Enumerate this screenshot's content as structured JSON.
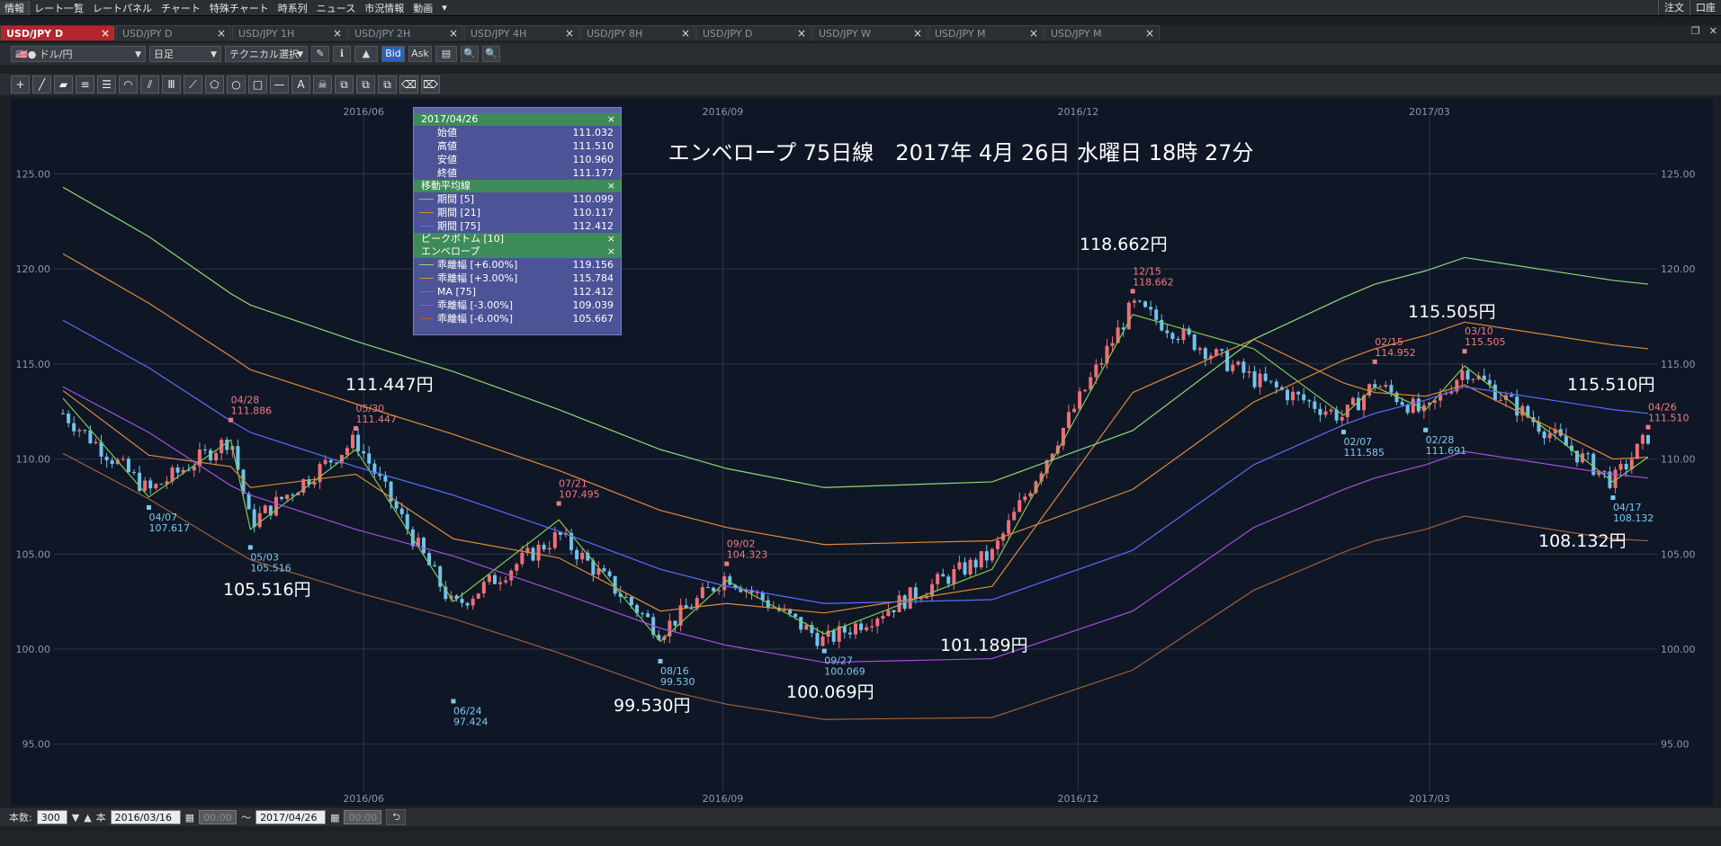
{
  "menu": {
    "items": [
      "情報",
      "レート一覧",
      "レートパネル",
      "チャート",
      "特殊チャート",
      "時系列",
      "ニュース",
      "市況情報",
      "動画",
      "▾"
    ],
    "right": [
      "注文",
      "口座"
    ]
  },
  "tabs": [
    {
      "label": "USD/JPY D",
      "active": true
    },
    {
      "label": "USD/JPY D",
      "active": false
    },
    {
      "label": "USD/JPY 1H",
      "active": false
    },
    {
      "label": "USD/JPY 2H",
      "active": false
    },
    {
      "label": "USD/JPY 4H",
      "active": false
    },
    {
      "label": "USD/JPY 8H",
      "active": false
    },
    {
      "label": "USD/JPY D",
      "active": false
    },
    {
      "label": "USD/JPY W",
      "active": false
    },
    {
      "label": "USD/JPY M",
      "active": false
    },
    {
      "label": "USD/JPY M",
      "active": false
    }
  ],
  "toolbar": {
    "pair": "ドル/円",
    "period": "日足",
    "technical": "テクニカル選択",
    "bid": "Bid",
    "ask": "Ask"
  },
  "chart_title": "エンベロープ 75日線　2017年 4月 26日 水曜日 18時 27分",
  "axes": {
    "x_ticks": [
      "2016/06",
      "2016/09",
      "2016/12",
      "2017/03"
    ],
    "y_ticks": [
      "125.00",
      "120.00",
      "115.00",
      "110.00",
      "105.00",
      "100.00",
      "95.00"
    ]
  },
  "legend": {
    "date": "2017/04/26",
    "ohlc": [
      {
        "label": "始値",
        "value": "111.032"
      },
      {
        "label": "高値",
        "value": "111.510"
      },
      {
        "label": "安値",
        "value": "110.960"
      },
      {
        "label": "終値",
        "value": "111.177"
      }
    ],
    "ma_header": "移動平均線",
    "ma": [
      {
        "label": "期間 [5]",
        "value": "110.099",
        "color": "#7ec850"
      },
      {
        "label": "期間 [21]",
        "value": "110.117",
        "color": "#e08a38"
      },
      {
        "label": "期間 [75]",
        "value": "112.412",
        "color": "#5a6cff"
      }
    ],
    "peak_header": "ピークボトム [10]",
    "env_header": "エンベロープ",
    "env": [
      {
        "label": "乖離幅 [+6.00%]",
        "value": "119.156",
        "color": "#8fd77a"
      },
      {
        "label": "乖離幅 [+3.00%]",
        "value": "115.784",
        "color": "#e08a38"
      },
      {
        "label": "MA [75]",
        "value": "112.412",
        "color": "#5a6cff"
      },
      {
        "label": "乖離幅 [-3.00%]",
        "value": "109.039",
        "color": "#a64fe0"
      },
      {
        "label": "乖離幅 [-6.00%]",
        "value": "105.667",
        "color": "#a0603a"
      }
    ],
    "close": "×"
  },
  "peaks": [
    {
      "date": "04/28",
      "value": "111.886",
      "type": "high"
    },
    {
      "date": "05/30",
      "value": "111.447",
      "type": "high"
    },
    {
      "date": "07/21",
      "value": "107.495",
      "type": "high"
    },
    {
      "date": "09/02",
      "value": "104.323",
      "type": "high"
    },
    {
      "date": "12/15",
      "value": "118.662",
      "type": "high"
    },
    {
      "date": "02/15",
      "value": "114.952",
      "type": "high"
    },
    {
      "date": "03/10",
      "value": "115.505",
      "type": "high"
    },
    {
      "date": "04/26",
      "value": "111.510",
      "type": "high"
    },
    {
      "date": "04/07",
      "value": "107.617",
      "type": "low"
    },
    {
      "date": "05/03",
      "value": "105.516",
      "type": "low"
    },
    {
      "date": "06/24",
      "value": "97.424",
      "type": "low"
    },
    {
      "date": "08/16",
      "value": "99.530",
      "type": "low"
    },
    {
      "date": "09/27",
      "value": "100.069",
      "type": "low"
    },
    {
      "date": "02/07",
      "value": "111.585",
      "type": "low"
    },
    {
      "date": "02/28",
      "value": "111.691",
      "type": "low"
    },
    {
      "date": "04/17",
      "value": "108.132",
      "type": "low"
    }
  ],
  "annotations": [
    "111.447円",
    "105.516円",
    "99.530円",
    "100.069円",
    "101.189円",
    "118.662円",
    "115.505円",
    "115.510円",
    "108.132円"
  ],
  "bottom": {
    "count_label": "本数:",
    "count": "300",
    "unit": "本",
    "from_date": "2016/03/16",
    "from_time": "00:00",
    "tilde": "～",
    "to_date": "2017/04/26",
    "to_time": "00:00"
  },
  "chart_data": {
    "type": "line",
    "title": "エンベロープ 75日線　2017年 4月 26日 水曜日 18時 27分",
    "ylim": [
      93,
      128
    ],
    "x_ticks": [
      "2016/06",
      "2016/09",
      "2016/12",
      "2017/03"
    ],
    "y_ticks": [
      125,
      120,
      115,
      110,
      105,
      100,
      95
    ],
    "grid": true,
    "x": [
      "2016/03/16",
      "2016/04/07",
      "2016/04/28",
      "2016/05/03",
      "2016/05/30",
      "2016/06/24",
      "2016/07/21",
      "2016/08/16",
      "2016/09/02",
      "2016/09/27",
      "2016/11/09",
      "2016/12/15",
      "2017/01/15",
      "2017/02/07",
      "2017/02/15",
      "2017/02/28",
      "2017/03/10",
      "2017/04/17",
      "2017/04/26"
    ],
    "series": [
      {
        "name": "期間 [5]",
        "color": "#7ec850",
        "values": [
          113.2,
          108.0,
          111.0,
          106.3,
          110.5,
          102.5,
          106.8,
          100.4,
          103.6,
          100.8,
          104.2,
          117.6,
          115.8,
          112.3,
          113.8,
          112.6,
          114.9,
          108.8,
          110.1
        ]
      },
      {
        "name": "期間 [21]",
        "color": "#e08a38",
        "values": [
          113.6,
          110.2,
          109.6,
          108.5,
          109.2,
          105.8,
          104.8,
          102.0,
          102.4,
          101.9,
          103.3,
          113.5,
          116.3,
          114.0,
          113.5,
          113.3,
          113.9,
          110.0,
          110.1
        ]
      },
      {
        "name": "MA [75]",
        "color": "#5a6cff",
        "values": [
          117.3,
          114.8,
          112.0,
          111.4,
          109.6,
          108.1,
          106.2,
          104.2,
          103.3,
          102.4,
          102.6,
          105.2,
          109.7,
          111.8,
          112.4,
          113.1,
          113.8,
          112.6,
          112.4
        ]
      },
      {
        "name": "乖離幅 [+6.00%]",
        "color": "#8fd77a",
        "values": [
          124.3,
          121.7,
          118.7,
          118.1,
          116.2,
          114.6,
          112.6,
          110.5,
          109.5,
          108.5,
          108.8,
          111.5,
          116.3,
          118.5,
          119.2,
          119.9,
          120.6,
          119.4,
          119.2
        ]
      },
      {
        "name": "乖離幅 [+3.00%]",
        "color": "#e08a38",
        "values": [
          120.8,
          118.2,
          115.4,
          114.7,
          112.9,
          111.3,
          109.4,
          107.3,
          106.4,
          105.5,
          105.7,
          108.4,
          113.0,
          115.2,
          115.8,
          116.5,
          117.2,
          116.0,
          115.8
        ]
      },
      {
        "name": "乖離幅 [-3.00%]",
        "color": "#a64fe0",
        "values": [
          113.8,
          111.4,
          108.6,
          108.1,
          106.3,
          104.9,
          103.0,
          101.1,
          100.2,
          99.3,
          99.5,
          102.0,
          106.4,
          108.4,
          109.0,
          109.7,
          110.4,
          109.2,
          109.0
        ]
      },
      {
        "name": "乖離幅 [-6.00%]",
        "color": "#a0603a",
        "values": [
          110.3,
          107.9,
          105.3,
          104.7,
          103.0,
          101.6,
          99.8,
          97.9,
          97.1,
          96.3,
          96.4,
          98.9,
          103.1,
          105.1,
          105.7,
          106.3,
          107.0,
          105.8,
          105.7
        ]
      }
    ],
    "candles": {
      "x": [
        "2016/03/16",
        "2016/04/07",
        "2016/04/28",
        "2016/05/03",
        "2016/05/30",
        "2016/06/24",
        "2016/07/21",
        "2016/08/16",
        "2016/09/02",
        "2016/09/27",
        "2016/11/09",
        "2016/12/15",
        "2017/01/15",
        "2017/02/07",
        "2017/02/15",
        "2017/02/28",
        "2017/03/10",
        "2017/04/17",
        "2017/04/26"
      ],
      "close": [
        112.4,
        108.3,
        111.1,
        106.6,
        111.0,
        102.2,
        106.0,
        100.9,
        103.9,
        100.4,
        105.0,
        118.1,
        114.2,
        112.2,
        114.0,
        112.3,
        114.8,
        108.8,
        111.2
      ]
    }
  }
}
